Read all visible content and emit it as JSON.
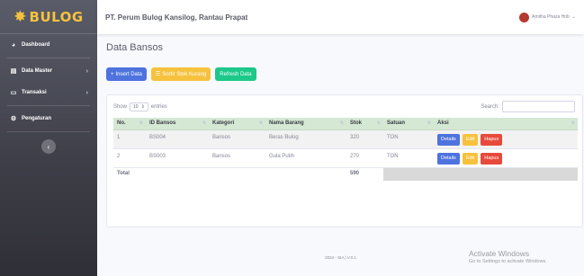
{
  "brand": {
    "name": "BULOG"
  },
  "sidebar": {
    "items": [
      {
        "label": "Dashboard",
        "icon": "dashboard-icon"
      },
      {
        "label": "Data Master",
        "icon": "database-icon"
      },
      {
        "label": "Transaksi",
        "icon": "monitor-icon"
      },
      {
        "label": "Pengaturan",
        "icon": "cogs-icon"
      }
    ]
  },
  "topbar": {
    "company": "PT. Perum Bulog Kansilog, Rantau Prapat",
    "user": "Amitha Phaza Hrib"
  },
  "page": {
    "title": "Data Bansos"
  },
  "buttons": {
    "insert": "Insert Data",
    "sortir": "Sortir Stok Kurang",
    "refresh": "Refresh Data"
  },
  "table_controls": {
    "show": "Show",
    "entries_value": "10",
    "entries": "entries",
    "search_label": "Search:"
  },
  "table": {
    "headers": [
      "No.",
      "ID Bansos",
      "Kategori",
      "Nama Barang",
      "Stok",
      "Satuan",
      "Aksi"
    ],
    "rows": [
      {
        "no": "1",
        "id": "BS004",
        "kategori": "Bansos",
        "nama": "Beras Bulog",
        "stok": "320",
        "satuan": "TON"
      },
      {
        "no": "2",
        "id": "BS003",
        "kategori": "Bansos",
        "nama": "Gula Putih",
        "stok": "270",
        "satuan": "TON"
      }
    ],
    "action_labels": {
      "details": "Details",
      "edit": "Edit",
      "hapus": "Hapus"
    },
    "total_label": "Total",
    "total_value": "590"
  },
  "footer": {
    "text": "2024 - SIA | V.0.1"
  },
  "watermark": {
    "line1": "Activate Windows",
    "line2": "Go to Settings to activate Windows."
  },
  "colors": {
    "primary": "#4e73df",
    "warning": "#f6c23e",
    "success": "#1cc88a",
    "danger": "#e74a3b",
    "brand": "#f6c23e"
  }
}
